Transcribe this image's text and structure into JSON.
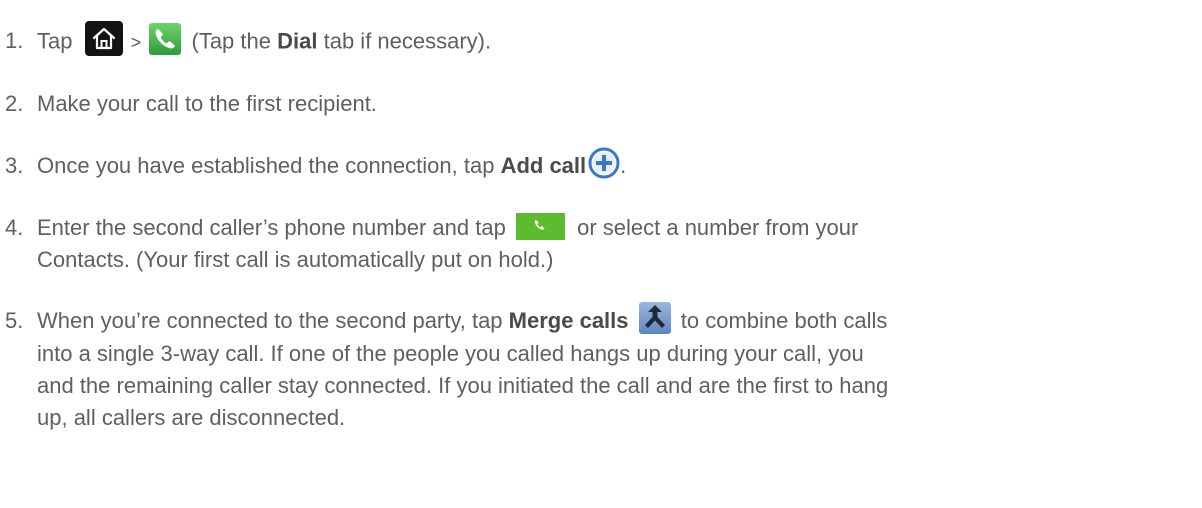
{
  "steps": [
    {
      "number": "1.",
      "parts": {
        "a": "Tap",
        "gt": ">",
        "b": "(Tap the",
        "bold": "Dial",
        "c": "tab if necessary)."
      }
    },
    {
      "number": "2.",
      "text": "Make your call to the first recipient."
    },
    {
      "number": "3.",
      "parts": {
        "a": "Once you have established the connection, tap",
        "bold": "Add call",
        "end": "."
      }
    },
    {
      "number": "4.",
      "parts": {
        "a": "Enter the second caller’s phone number and tap",
        "b": "or select a number from your",
        "line2": "Contacts. (Your first call is automatically put on hold.)"
      }
    },
    {
      "number": "5.",
      "parts": {
        "a": "When you’re connected to the second party, tap",
        "bold": "Merge calls",
        "b": "to combine both calls",
        "line2": "into a single 3-way call. If one of the people you called hangs up during your call, you",
        "line3": "and the remaining caller stay connected. If you initiated the call and are the first to hang",
        "line4": "up, all callers are disconnected."
      }
    }
  ],
  "icons": {
    "home": "home-icon",
    "phone": "phone-icon",
    "add_call": "plus-circle-icon",
    "dial_button": "phone-button-icon",
    "merge": "merge-calls-icon"
  },
  "colors": {
    "text": "#5f5f5f",
    "bold_text": "#4a4a4a",
    "icon_dark": "#1a1a1a",
    "phone_green": "#39b54a",
    "dial_green": "#5dbb2f",
    "icon_blue": "#3a77c7"
  }
}
